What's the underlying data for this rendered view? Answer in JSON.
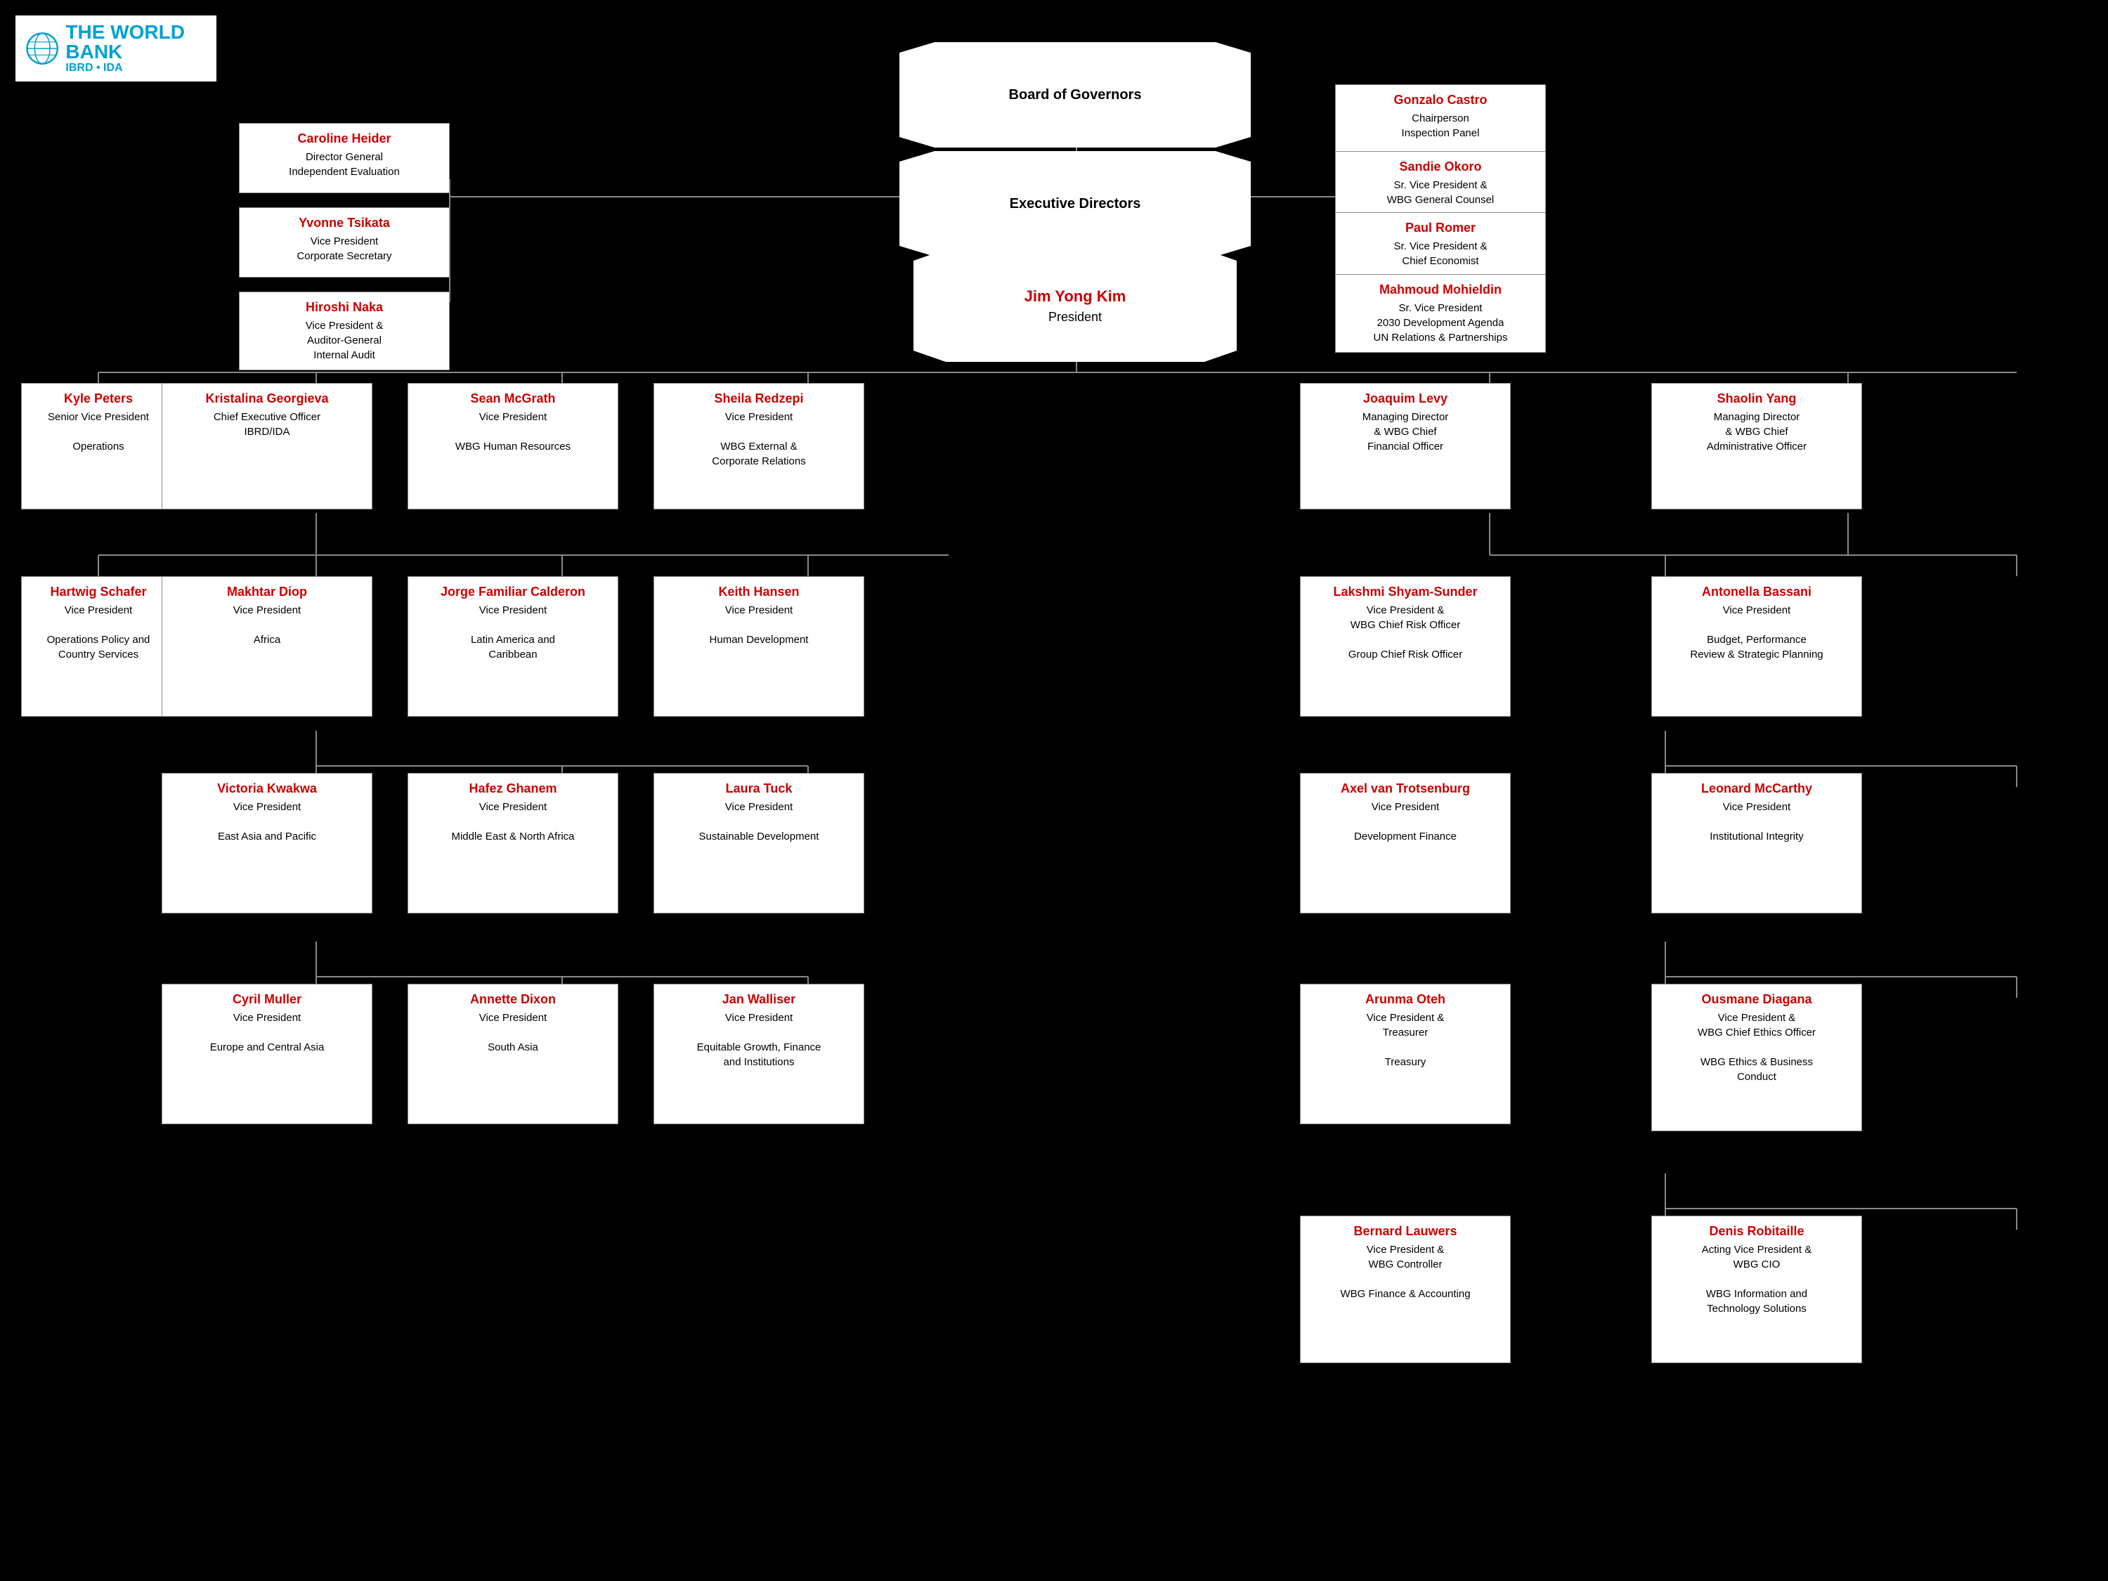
{
  "logo": {
    "title": "THE WORLD BANK",
    "sub": "IBRD • IDA"
  },
  "board": {
    "label": "Board of Governors"
  },
  "exec_directors": {
    "label": "Executive Directors"
  },
  "president": {
    "name": "Jim Yong Kim",
    "role": "President"
  },
  "top_left_cards": [
    {
      "name": "Caroline Heider",
      "role": "Director General\nIndependent Evaluation"
    },
    {
      "name": "Yvonne Tsikata",
      "role": "Vice President\nCorporate Secretary"
    },
    {
      "name": "Hiroshi Naka",
      "role": "Vice President &\nAuditor-General\nInternal Audit"
    }
  ],
  "top_right_cards": [
    {
      "name": "Gonzalo Castro",
      "role": "Chairperson\nInspection Panel"
    },
    {
      "name": "Sandie Okoro",
      "role": "Sr. Vice President &\nWBG General Counsel"
    },
    {
      "name": "Paul Romer",
      "role": "Sr. Vice President &\nChief Economist"
    },
    {
      "name": "Mahmoud Mohieldin",
      "role": "Sr. Vice President\n2030 Development Agenda\nUN Relations & Partnerships"
    }
  ],
  "mid_level": [
    {
      "name": "Kyle Peters",
      "role": "Senior Vice President\n\nOperations"
    },
    {
      "name": "Kristalina Georgieva",
      "role": "Chief Executive Officer\nIBRD/IDA"
    },
    {
      "name": "Sean McGrath",
      "role": "Vice President\n\nWBG Human Resources"
    },
    {
      "name": "Sheila Redzepi",
      "role": "Vice President\n\nWBG External &\nCorporate Relations"
    },
    {
      "name": "Joaquim Levy",
      "role": "Managing Director\n& WBG Chief\nFinancial Officer"
    },
    {
      "name": "Shaolin Yang",
      "role": "Managing Director\n& WBG Chief\nAdministrative Officer"
    }
  ],
  "row2": [
    {
      "name": "Hartwig Schafer",
      "role": "Vice President\n\nOperations Policy and\nCountry Services"
    },
    {
      "name": "Makhtar Diop",
      "role": "Vice President\n\nAfrica"
    },
    {
      "name": "Jorge Familiar Calderon",
      "role": "Vice President\n\nLatin America and\nCaribbean"
    },
    {
      "name": "Keith Hansen",
      "role": "Vice President\n\nHuman Development"
    },
    {
      "name": "Lakshmi Shyam-Sunder",
      "role": "Vice President &\nWBG Chief Risk Officer\n\nGroup Chief Risk Officer"
    },
    {
      "name": "Antonella Bassani",
      "role": "Vice President\n\nBudget, Performance\nReview & Strategic Planning"
    }
  ],
  "row3": [
    {
      "name": "Victoria Kwakwa",
      "role": "Vice President\n\nEast Asia and Pacific"
    },
    {
      "name": "Hafez Ghanem",
      "role": "Vice President\n\nMiddle East & North Africa"
    },
    {
      "name": "Laura Tuck",
      "role": "Vice President\n\nSustainable Development"
    },
    {
      "name": "Axel van Trotsenburg",
      "role": "Vice President\n\nDevelopment Finance"
    },
    {
      "name": "Leonard McCarthy",
      "role": "Vice President\n\nInstitutional Integrity"
    }
  ],
  "row4": [
    {
      "name": "Cyril Muller",
      "role": "Vice President\n\nEurope and Central Asia"
    },
    {
      "name": "Annette Dixon",
      "role": "Vice President\n\nSouth Asia"
    },
    {
      "name": "Jan Walliser",
      "role": "Vice President\n\nEquitable Growth, Finance\nand Institutions"
    },
    {
      "name": "Arunma Oteh",
      "role": "Vice President &\nTreasurer\n\nTreasury"
    },
    {
      "name": "Ousmane Diagana",
      "role": "Vice President  &\nWBG Chief Ethics Officer\n\nWBG Ethics & Business\nConduct"
    }
  ],
  "row5": [
    {
      "name": "Bernard Lauwers",
      "role": "Vice President &\nWBG Controller\n\nWBG Finance & Accounting"
    },
    {
      "name": "Denis Robitaille",
      "role": "Acting Vice President &\nWBG CIO\n\nWBG Information and\nTechnology Solutions"
    }
  ]
}
